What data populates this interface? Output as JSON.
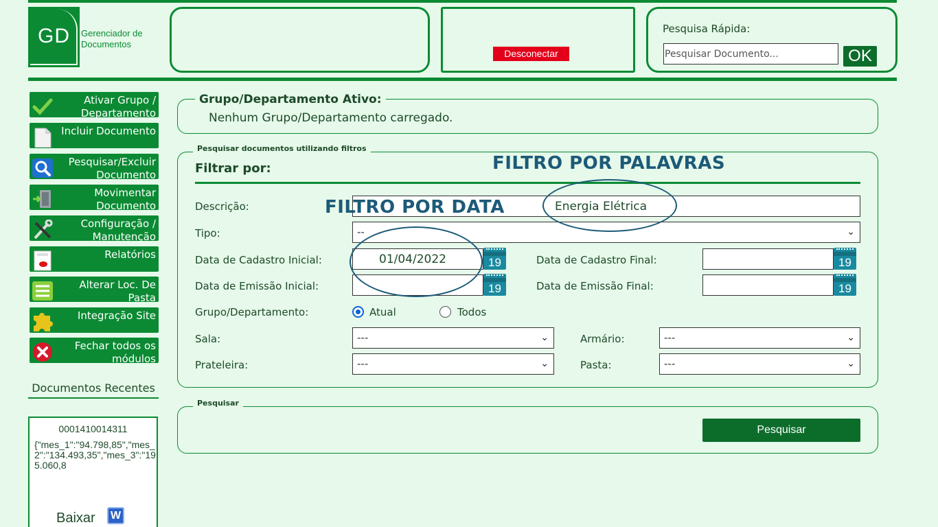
{
  "header": {
    "logo_text": "GD",
    "app_title_line1": "Gerenciador de",
    "app_title_line2": "Documentos",
    "disconnect_label": "Desconectar",
    "quick_search_label": "Pesquisa Rápida:",
    "quick_search_placeholder": "Pesquisar Documento...",
    "quick_search_button": "OK",
    "brand_color": "#0b8a33"
  },
  "sidebar": {
    "items": [
      {
        "line1": "Ativar Grupo /",
        "line2": "Departamento",
        "icon": "checkmark-icon"
      },
      {
        "line1": "Incluir Documento",
        "line2": "",
        "icon": "document-icon"
      },
      {
        "line1": "Pesquisar/Excluir",
        "line2": "Documento",
        "icon": "magnifier-icon"
      },
      {
        "line1": "Movimentar",
        "line2": "Documento",
        "icon": "move-document-icon"
      },
      {
        "line1": "Configuração /",
        "line2": "Manutenção",
        "icon": "tools-icon"
      },
      {
        "line1": "Relatórios",
        "line2": "",
        "icon": "report-icon"
      },
      {
        "line1": "Alterar Loc. De",
        "line2": "Pasta",
        "icon": "list-icon"
      },
      {
        "line1": "Integração Site",
        "line2": "",
        "icon": "puzzle-icon"
      },
      {
        "line1": "Fechar todos os",
        "line2": "módulos",
        "icon": "close-icon"
      }
    ]
  },
  "recent": {
    "title": "Documentos Recentes",
    "code": "0001410014311",
    "data_preview": "{\"mes_1\":\"94.798,85\",\"mes_2\":\"134.493,35\",\"mes_3\":\"195.060,8",
    "download_label": "Baixar",
    "word_icon_letter": "W"
  },
  "active_group": {
    "legend": "Grupo/Departamento Ativo:",
    "message": "Nenhum Grupo/Departamento carregado."
  },
  "filters": {
    "legend": "Pesquisar documentos utilizando filtros",
    "title": "Filtrar por:",
    "descricao_label": "Descrição:",
    "descricao_value": "Energia Elétrica",
    "tipo_label": "Tipo:",
    "tipo_value": "--",
    "cad_ini_label": "Data de Cadastro Inicial:",
    "cad_ini_value": "01/04/2022",
    "cad_fim_label": "Data de Cadastro Final:",
    "cad_fim_value": "",
    "emi_ini_label": "Data de Emissão Inicial:",
    "emi_ini_value": "",
    "emi_fim_label": "Data de Emissão Final:",
    "emi_fim_value": "",
    "calendar_day": "19",
    "grupo_label": "Grupo/Departamento:",
    "grupo_options": {
      "atual": "Atual",
      "todos": "Todos"
    },
    "grupo_selected": "atual",
    "sala_label": "Sala:",
    "sala_value": "---",
    "armario_label": "Armário:",
    "armario_value": "---",
    "prateleira_label": "Prateleira:",
    "prateleira_value": "---",
    "pasta_label": "Pasta:",
    "pasta_value": "---"
  },
  "search_section": {
    "legend": "Pesquisar",
    "button_label": "Pesquisar"
  },
  "annotations": {
    "words_filter": "FILTRO POR PALAVRAS",
    "date_filter": "FILTRO POR DATA",
    "color": "#1c5a78"
  }
}
